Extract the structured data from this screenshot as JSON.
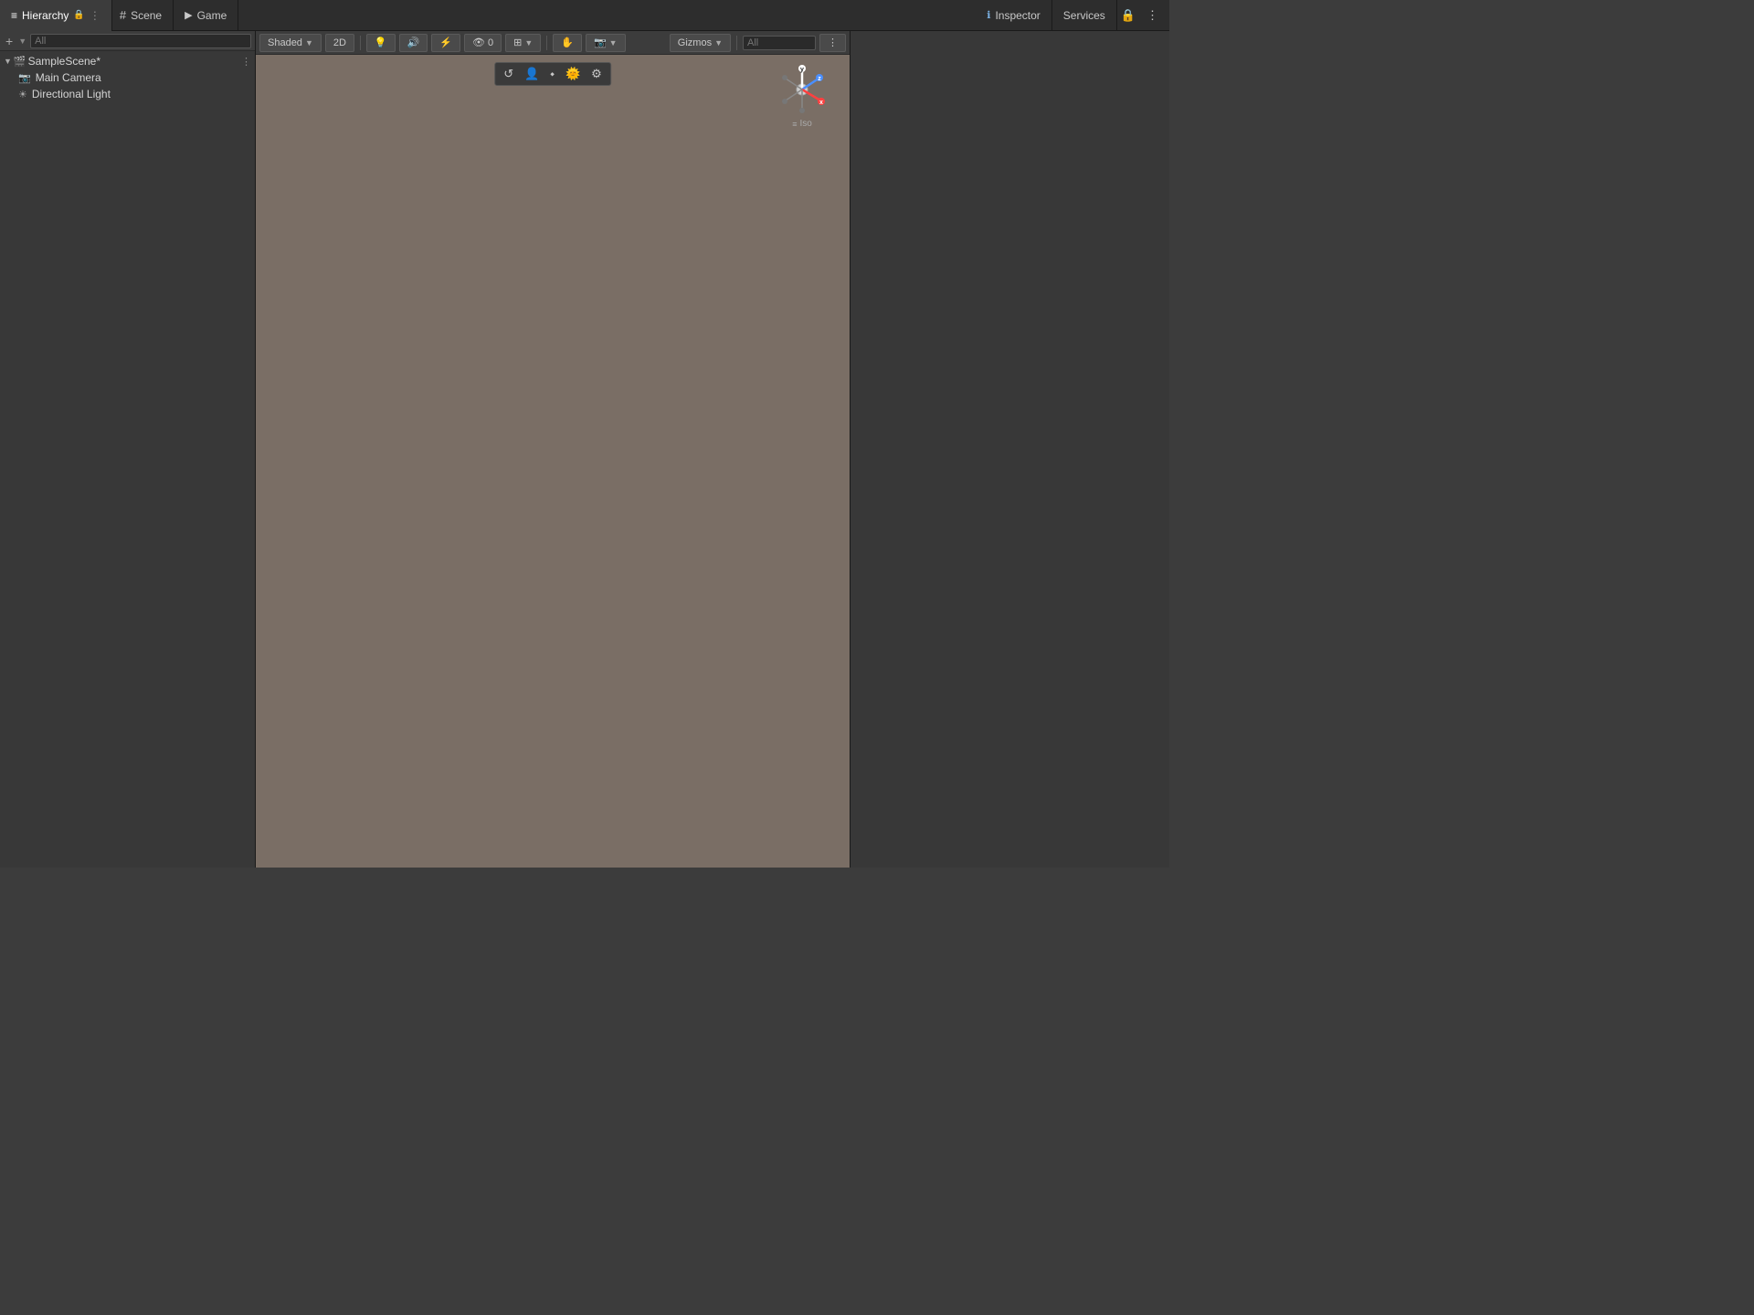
{
  "tabs": {
    "hierarchy": {
      "label": "Hierarchy",
      "icon": "≡"
    },
    "scene": {
      "label": "Scene",
      "icon": "#"
    },
    "game": {
      "label": "Game",
      "icon": "▶"
    }
  },
  "inspector": {
    "label": "Inspector",
    "icon": "ℹ",
    "services_label": "Services"
  },
  "hierarchy": {
    "search_placeholder": "All",
    "scene_name": "SampleScene*",
    "items": [
      {
        "name": "Main Camera",
        "icon": "📷",
        "type": "camera"
      },
      {
        "name": "Directional Light",
        "icon": "☀",
        "type": "light"
      }
    ]
  },
  "scene_toolbar": {
    "shading_mode": "Shaded",
    "projection": "2D",
    "gizmos_label": "Gizmos",
    "search_placeholder": "All",
    "overlay_buttons": [
      {
        "icon": "↺",
        "label": "refresh"
      },
      {
        "icon": "👤",
        "label": "person"
      },
      {
        "icon": "⚡",
        "label": "lightning"
      },
      {
        "icon": "⚙",
        "label": "settings"
      }
    ]
  },
  "gizmo": {
    "label": "Iso",
    "axes": {
      "y": {
        "label": "y",
        "color": "#ffffff"
      },
      "z": {
        "label": "z",
        "color": "#3a8fff"
      },
      "x": {
        "label": "x",
        "color": "#ff3a3a"
      }
    }
  },
  "toolbar": {
    "add_button": "+",
    "more_button": "⋮",
    "lock_button": "🔒",
    "menu_button": "⋮"
  },
  "colors": {
    "background": "#3c3c3c",
    "panel": "#383838",
    "topbar": "#2d2d2d",
    "scene_bg": "#7a6e65",
    "selected_blue": "#2d5a8e",
    "accent": "#4a9eff"
  }
}
